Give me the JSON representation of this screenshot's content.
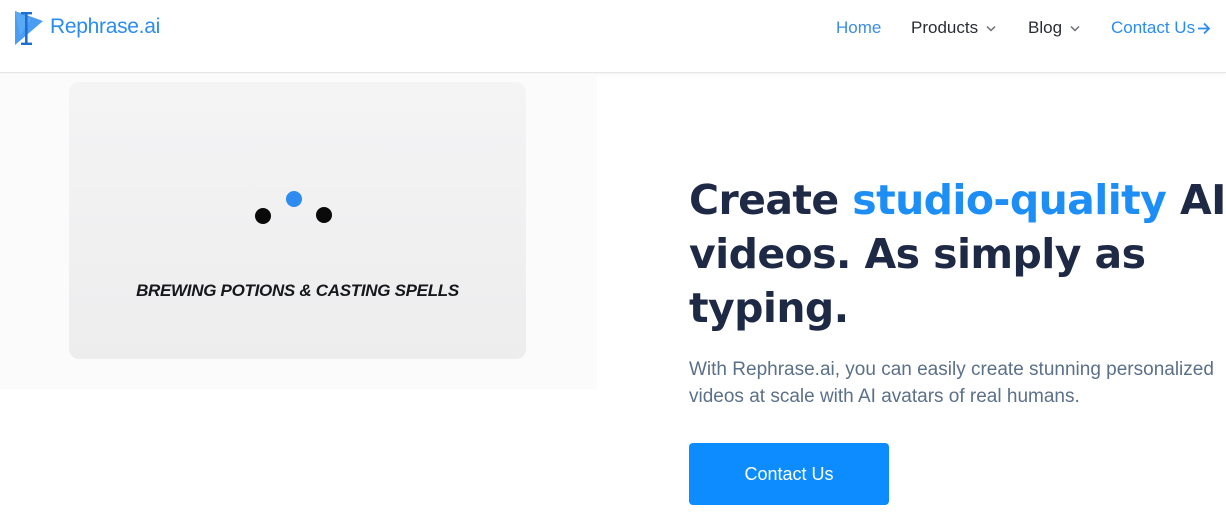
{
  "brand": {
    "name": "Rephrase.ai",
    "color": "#2a8cf0"
  },
  "nav": {
    "home": "Home",
    "products": "Products",
    "blog": "Blog",
    "contact": "Contact Us",
    "active_color": "#3b8ede"
  },
  "preview": {
    "loading_text": "BREWING POTIONS & CASTING SPELLS",
    "dot_colors": [
      "#0a0a0a",
      "#2e8cf0",
      "#0a0a0a"
    ]
  },
  "hero": {
    "headline_part1": "Create ",
    "headline_accent": "studio-quality",
    "headline_part2": " AI videos. As simply as typing.",
    "subtext": "With Rephrase.ai, you can easily create stunning personalized videos at scale with AI avatars of real humans.",
    "cta_label": "Contact Us",
    "accent_color": "#1d8ef5"
  },
  "icons": {
    "logo": "rephrase-logo-icon",
    "products_chevron": "chevron-down-icon",
    "blog_chevron": "chevron-down-icon",
    "contact_arrow": "arrow-right-icon"
  }
}
